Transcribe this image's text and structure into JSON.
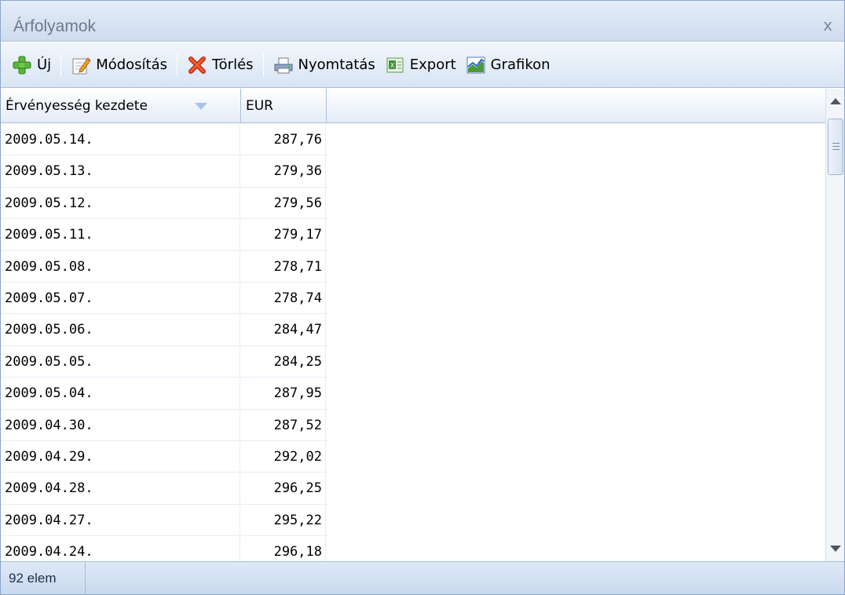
{
  "window": {
    "title": "Árfolyamok",
    "close_glyph": "x"
  },
  "toolbar": {
    "new_label": "Új",
    "edit_label": "Módosítás",
    "delete_label": "Törlés",
    "print_label": "Nyomtatás",
    "export_label": "Export",
    "chart_label": "Grafikon",
    "icons": [
      "plus-icon",
      "edit-icon",
      "delete-icon",
      "printer-icon",
      "excel-icon",
      "chart-icon"
    ]
  },
  "grid": {
    "columns": [
      "Érvényesség kezdete",
      "EUR"
    ],
    "sort_column": "Érvényesség kezdete",
    "sort_direction": "descending",
    "rows": [
      {
        "date": "2009.05.14.",
        "eur": "287,76"
      },
      {
        "date": "2009.05.13.",
        "eur": "279,36"
      },
      {
        "date": "2009.05.12.",
        "eur": "279,56"
      },
      {
        "date": "2009.05.11.",
        "eur": "279,17"
      },
      {
        "date": "2009.05.08.",
        "eur": "278,71"
      },
      {
        "date": "2009.05.07.",
        "eur": "278,74"
      },
      {
        "date": "2009.05.06.",
        "eur": "284,47"
      },
      {
        "date": "2009.05.05.",
        "eur": "284,25"
      },
      {
        "date": "2009.05.04.",
        "eur": "287,95"
      },
      {
        "date": "2009.04.30.",
        "eur": "287,52"
      },
      {
        "date": "2009.04.29.",
        "eur": "292,02"
      },
      {
        "date": "2009.04.28.",
        "eur": "296,25"
      },
      {
        "date": "2009.04.27.",
        "eur": "295,22"
      },
      {
        "date": "2009.04.24.",
        "eur": "296,18"
      }
    ]
  },
  "status": {
    "count_text": "92 elem"
  },
  "colors": {
    "header_blue": "#cfdcee",
    "border_blue": "#a9bedb",
    "title_gray": "#6b7a8c"
  }
}
